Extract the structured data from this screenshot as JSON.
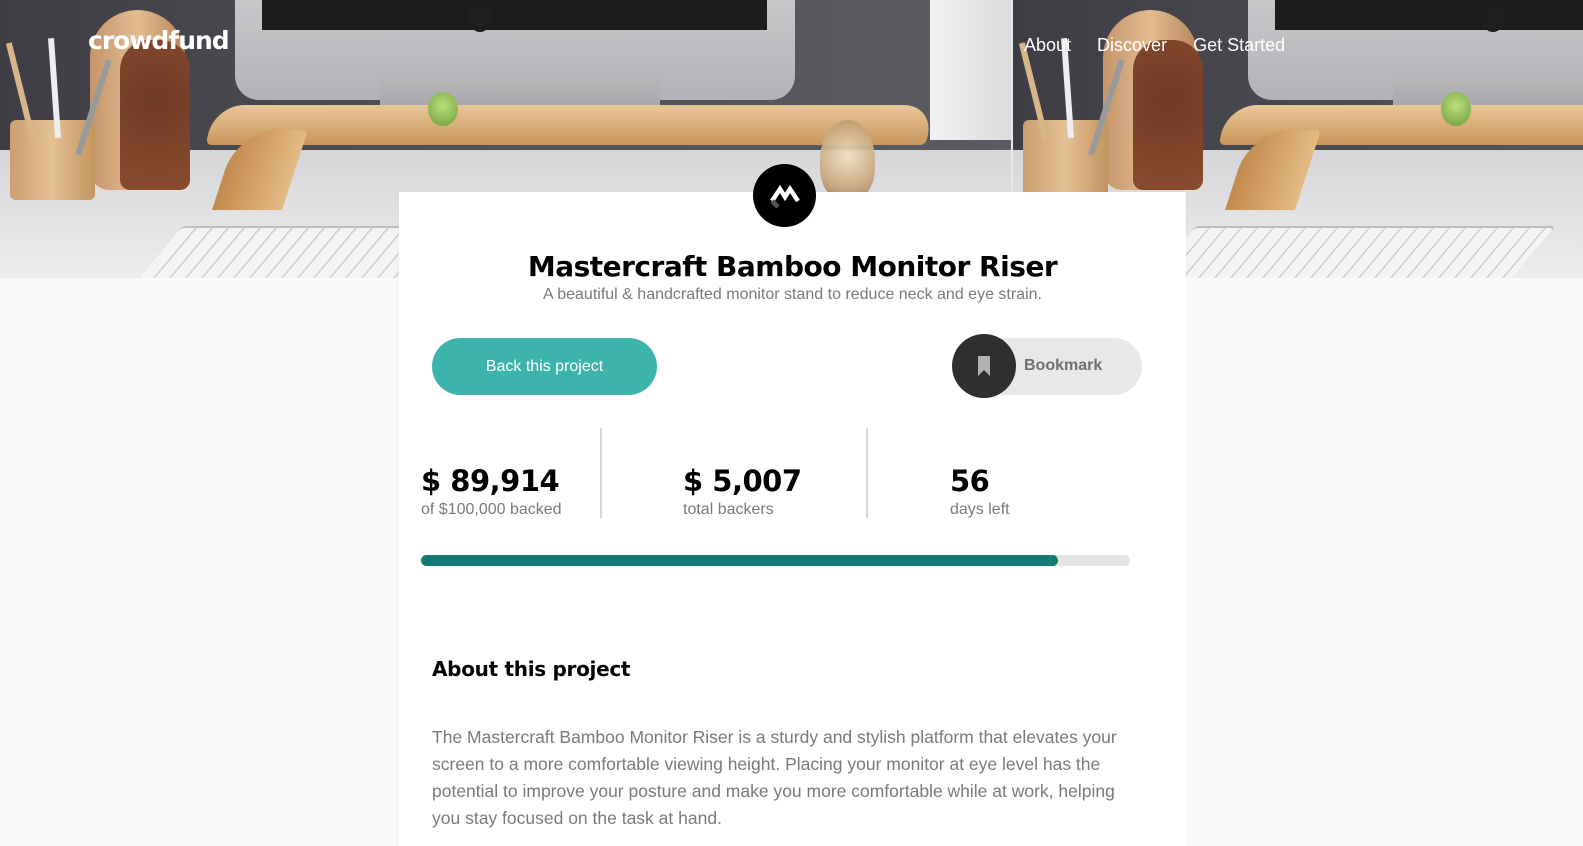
{
  "header": {
    "logo": "crowdfund",
    "nav": [
      {
        "label": "About"
      },
      {
        "label": "Discover"
      },
      {
        "label": "Get Started"
      }
    ]
  },
  "project": {
    "title": "Mastercraft Bamboo Monitor Riser",
    "subtitle": "A beautiful & handcrafted monitor stand to reduce neck and eye strain.",
    "back_button": "Back this project",
    "bookmark_label": "Bookmark",
    "stats": {
      "backed_value": "$ 89,914",
      "backed_label": "of $100,000 backed",
      "backers_value": "$ 5,007",
      "backers_label": "total backers",
      "days_value": "56",
      "days_label": "days left"
    },
    "progress_fraction": 0.899
  },
  "about": {
    "heading": "About this project",
    "paragraph": "The Mastercraft Bamboo Monitor Riser is a sturdy and stylish platform that elevates your screen to a more comfortable viewing height. Placing your monitor at eye level has the potential to improve your posture and make you more comfortable while at work, helping you stay focused on the task at hand."
  },
  "colors": {
    "accent": "#3cb3ab",
    "progress_fill": "#147a73",
    "bookmark_circle": "#2f2f2f"
  },
  "icons": {
    "brand": "mastercraft-logo-icon",
    "bookmark": "bookmark-icon"
  }
}
